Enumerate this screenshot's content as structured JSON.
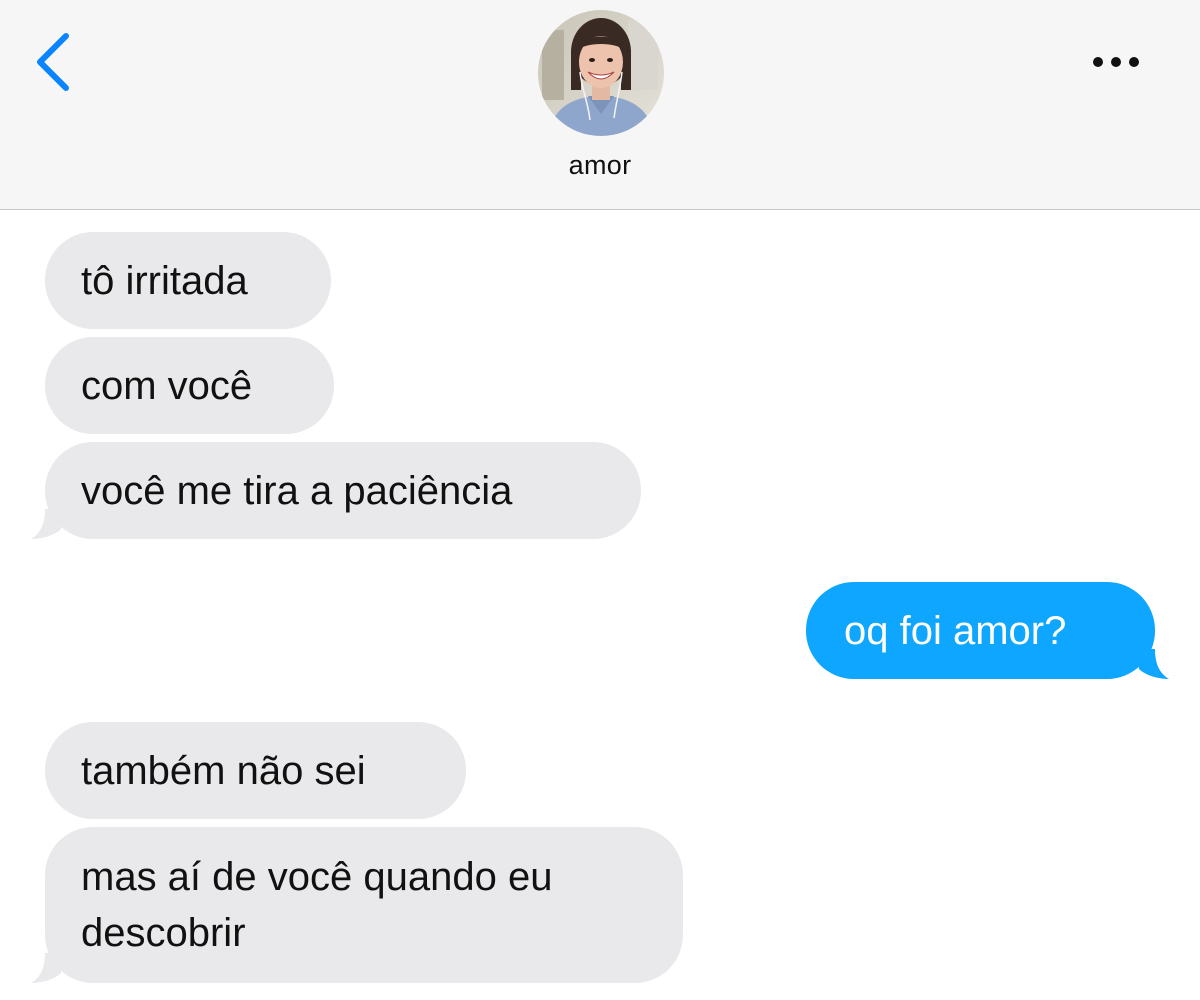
{
  "header": {
    "back_icon": "chevron-left-icon",
    "more_icon": "ellipsis-icon",
    "contact_name": "amor",
    "accent_color": "#0a84ff"
  },
  "messages": [
    {
      "direction": "incoming",
      "text": "tô irritada"
    },
    {
      "direction": "incoming",
      "text": "com você"
    },
    {
      "direction": "incoming",
      "text": "você me tira a paciência"
    },
    {
      "direction": "outgoing",
      "text": "oq foi amor?"
    },
    {
      "direction": "incoming",
      "text": "também não sei"
    },
    {
      "direction": "incoming",
      "lines": [
        "mas aí de você quando eu",
        "descobrir"
      ]
    }
  ],
  "colors": {
    "incoming_bubble": "#e9e9eb",
    "outgoing_bubble": "#0fa6ff",
    "header_bg": "#f6f6f6"
  }
}
